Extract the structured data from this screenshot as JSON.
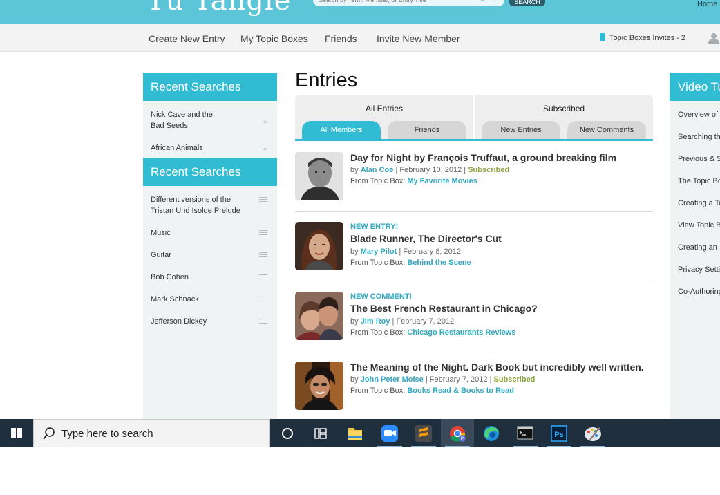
{
  "header": {
    "logo_text": "Tu Tangle",
    "search_placeholder": "Search by Term, Member, or Entry Title",
    "search_button": "SEARCH",
    "home_link": "Home"
  },
  "nav": {
    "items": [
      "Create New Entry",
      "My Topic Boxes",
      "Friends",
      "Invite New Member"
    ],
    "invites_label": "Topic Boxes Invites - 2"
  },
  "left_sidebar": {
    "section1": {
      "heading": "Recent Searches",
      "items": [
        {
          "line1": "Nick Cave and the",
          "line2": "Bad Seeds"
        },
        {
          "line1": "African Animals",
          "line2": ""
        }
      ]
    },
    "section2": {
      "heading": "Recent Searches",
      "items": [
        {
          "line1": "Different versions of the",
          "line2": "Tristan Und Isolde Prelude"
        },
        {
          "line1": "Music",
          "line2": ""
        },
        {
          "line1": "Guitar",
          "line2": ""
        },
        {
          "line1": "Bob Cohen",
          "line2": ""
        },
        {
          "line1": "Mark Schnack",
          "line2": ""
        },
        {
          "line1": "Jefferson Dickey",
          "line2": ""
        }
      ]
    }
  },
  "main": {
    "title": "Entries",
    "tab_groups": [
      "All Entries",
      "Subscribed"
    ],
    "subtabs": [
      "All Members",
      "Friends",
      "New Entries",
      "New Comments"
    ],
    "entries": [
      {
        "flag": "",
        "title": "Day for Night by François Truffaut, a ground breaking film",
        "by": "by",
        "author": "Alan Coe",
        "date": "| February 10, 2012 |",
        "subscribed": "Subscribed",
        "topic_prefix": "From Topic Box:",
        "topic_box": "My Favorite Movies"
      },
      {
        "flag": "NEW ENTRY!",
        "title": "Blade Runner, The Director's Cut",
        "by": "by",
        "author": "Mary Pilot",
        "date": "| February 8, 2012",
        "subscribed": "",
        "topic_prefix": "From Topic Box:",
        "topic_box": "Behind the Scene"
      },
      {
        "flag": "NEW COMMENT!",
        "title": "The Best French Restaurant in Chicago?",
        "by": "by",
        "author": "Jim Roy",
        "date": "| February 7, 2012",
        "subscribed": "",
        "topic_prefix": "From Topic Box:",
        "topic_box": "Chicago Restaurants Reviews"
      },
      {
        "flag": "",
        "title": "The Meaning of the Night. Dark Book but incredibly well written.",
        "by": "by",
        "author": "John Peter Moise",
        "date": "| February 7, 2012 |",
        "subscribed": "Subscribed",
        "topic_prefix": "From Topic Box:",
        "topic_box": "Books Read & Books to Read"
      }
    ]
  },
  "right_sidebar": {
    "heading": "Video Tu",
    "items": [
      "Overview of",
      "Searching th",
      "Previous & S",
      "The Topic Bo",
      "Creating a To",
      "View Topic B",
      "Creating an",
      "Privacy Setti",
      "Co-Authoring"
    ]
  },
  "taskbar": {
    "search_text": "Type here to search",
    "apps": [
      "cortana-icon",
      "task-view-icon",
      "file-explorer-icon",
      "zoom-icon",
      "sublime-text-icon",
      "chrome-icon",
      "edge-icon",
      "terminal-icon",
      "photoshop-icon",
      "paint-icon"
    ]
  },
  "colors": {
    "brand": "#31bcd3",
    "header": "#5cc5d8",
    "subscribed": "#8ca33b",
    "taskbar": "#1f2f3e"
  }
}
